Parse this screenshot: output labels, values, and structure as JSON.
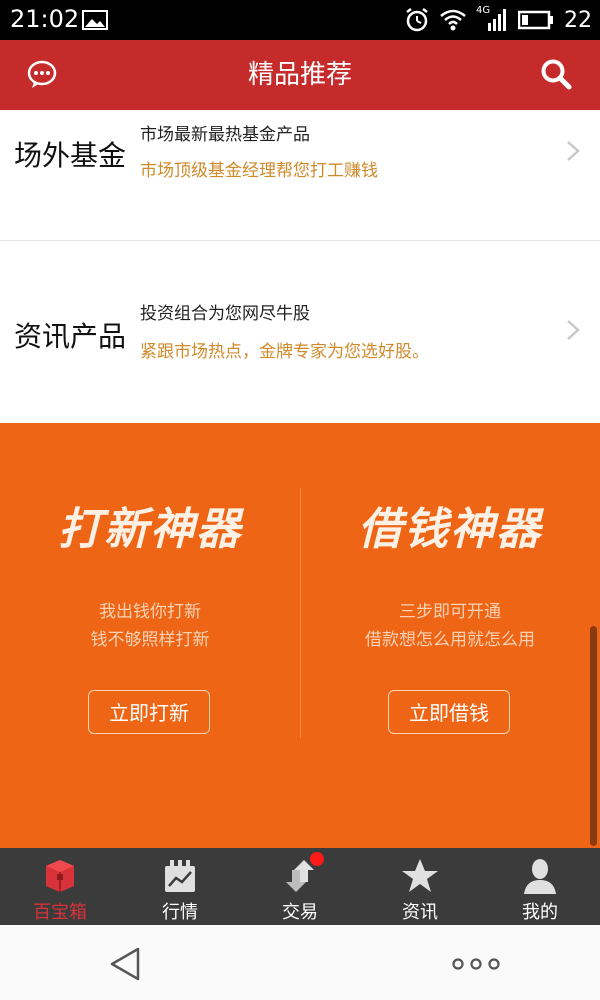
{
  "status_bar": {
    "time": "21:02",
    "network": "4G",
    "battery": "22"
  },
  "app_bar": {
    "title": "精品推荐"
  },
  "list": [
    {
      "title": "场外基金",
      "line1": "市场最新最热基金产品",
      "line2": "市场顶级基金经理帮您打工赚钱"
    },
    {
      "title": "资讯产品",
      "line1": "投资组合为您网尽牛股",
      "line2": "紧跟市场热点，金牌专家为您选好股。"
    }
  ],
  "promo": {
    "left": {
      "title": "打新神器",
      "line1": "我出钱你打新",
      "line2": "钱不够照样打新",
      "button": "立即打新"
    },
    "right": {
      "title": "借钱神器",
      "line1": "三步即可开通",
      "line2": "借款想怎么用就怎么用",
      "button": "立即借钱"
    }
  },
  "tabs": [
    {
      "label": "百宝箱",
      "icon": "treasure-box-icon",
      "active": true
    },
    {
      "label": "行情",
      "icon": "market-chart-icon",
      "active": false
    },
    {
      "label": "交易",
      "icon": "trade-arrows-icon",
      "active": false
    },
    {
      "label": "资讯",
      "icon": "star-icon",
      "active": false
    },
    {
      "label": "我的",
      "icon": "user-icon",
      "active": false
    }
  ],
  "colors": {
    "header_red": "#c62b2c",
    "promo_orange": "#ee6516",
    "subtitle_gold": "#d08a2a",
    "tab_active": "#d8323a",
    "tab_bg": "#3b3b3b"
  }
}
